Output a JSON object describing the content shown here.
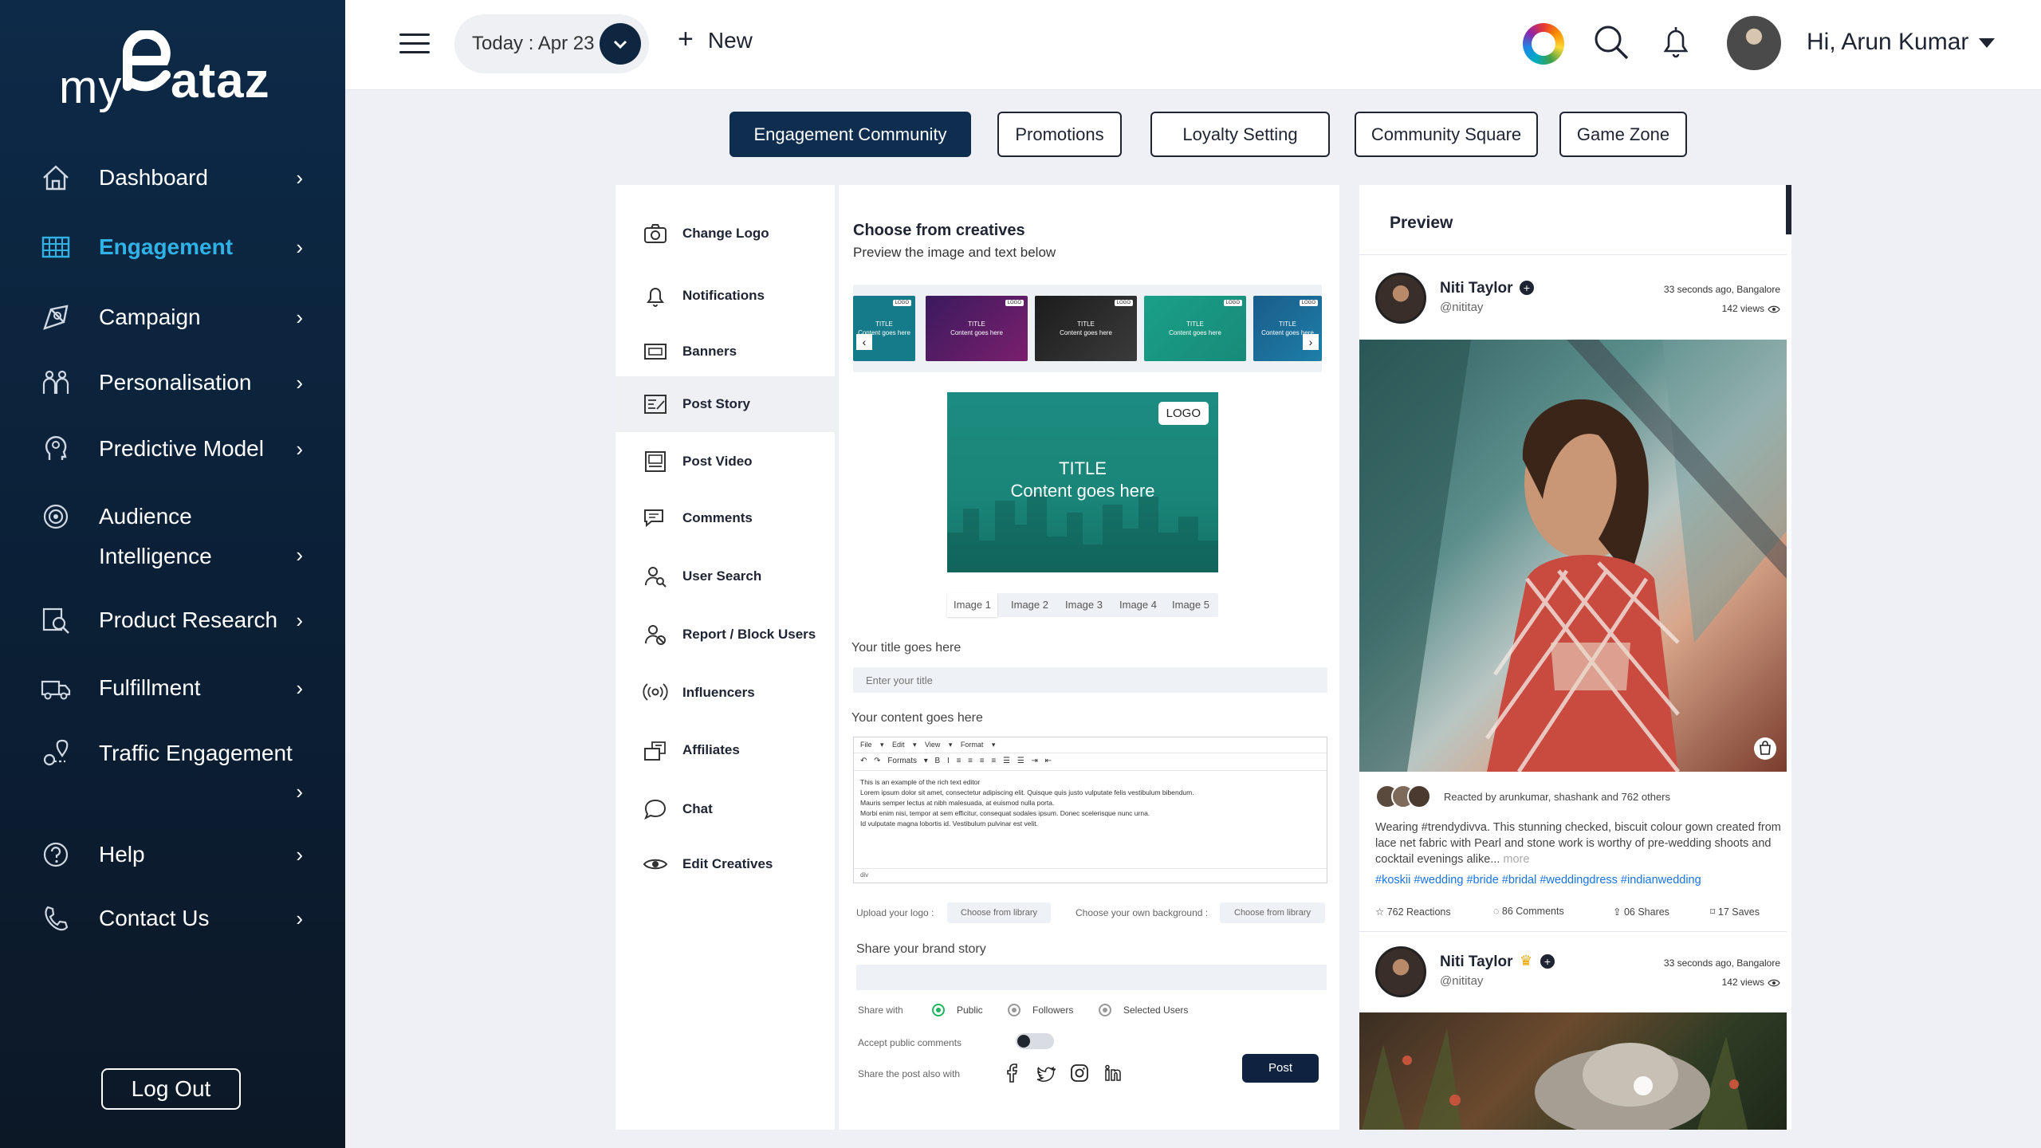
{
  "sidebar": {
    "logo_prefix": "my",
    "logo_suffix": "ataz",
    "logout": "Log Out",
    "items": [
      {
        "label": "Dashboard"
      },
      {
        "label": "Engagement"
      },
      {
        "label": "Campaign"
      },
      {
        "label": "Personalisation"
      },
      {
        "label": "Predictive Model"
      },
      {
        "label": "Audience Intelligence"
      },
      {
        "label": "Product Research"
      },
      {
        "label": "Fulfillment"
      },
      {
        "label": "Traffic Engagement"
      },
      {
        "label": "Help"
      },
      {
        "label": "Contact Us"
      }
    ]
  },
  "topbar": {
    "date_label": "Today : Apr 23",
    "new_label": "New",
    "greeting": "Hi, Arun Kumar"
  },
  "tabs": [
    "Engagement Community",
    "Promotions",
    "Loyalty Setting",
    "Community Square",
    "Game Zone"
  ],
  "menu": [
    "Change Logo",
    "Notifications",
    "Banners",
    "Post Story",
    "Post Video",
    "Comments",
    "User Search",
    "Report / Block Users",
    "Influencers",
    "Affiliates",
    "Chat",
    "Edit Creatives"
  ],
  "editor": {
    "title": "Choose from creatives",
    "subtitle": "Preview the image and text below",
    "thumb_title": "TITLE",
    "thumb_content": "Content goes here",
    "thumb_logo": "LOGO",
    "preview_logo": "LOGO",
    "preview_title": "TITLE",
    "preview_content": "Content goes here",
    "image_tabs": [
      "Image 1",
      "Image 2",
      "Image 3",
      "Image 4",
      "Image 5"
    ],
    "title_label": "Your title goes here",
    "title_placeholder": "Enter your title",
    "content_label": "Your content goes here",
    "rte_menu": "File ▾ Edit ▾ View ▾ Format ▾",
    "rte_tools": "↶ ↷ Formats ▾ B I ≡ ≡ ≡ ≡ ☰ ☰ ⇥ ⇤",
    "rte_line1": "This is an example of the rich text editor",
    "rte_line2": "Lorem ipsum dolor sit amet, consectetur adipiscing elit. Quisque quis justo vulputate felis vestibulum bibendum.",
    "rte_line3": "Mauris semper lectus at nibh malesuada, at euismod nulla porta.",
    "rte_line4": "Morbi enim nisi, tempor at sem efficitur, consequat sodales ipsum. Donec scelerisque nunc urna.",
    "rte_line5": "Id vulputate magna lobortis id. Vestibulum pulvinar est velit.",
    "rte_status": "div",
    "upload_logo_label": "Upload your logo :",
    "choose_library": "Choose from library",
    "own_bg_label": "Choose your own background :",
    "choose_library_2": "Choose from library",
    "brand_story_label": "Share your brand story",
    "share_with_label": "Share with",
    "share_options": [
      "Public",
      "Followers",
      "Selected Users"
    ],
    "accept_comments_label": "Accept public comments",
    "share_also_label": "Share the post also with",
    "post_button": "Post"
  },
  "preview": {
    "title": "Preview",
    "post1": {
      "name": "Niti Taylor",
      "handle": "@nititay",
      "meta": "33 seconds ago, Bangalore",
      "views": "142 views",
      "reacted_by": "Reacted by arunkumar, shashank and 762 others",
      "text": "Wearing #trendydivva. This stunning checked, biscuit colour gown created from lace net fabric with Pearl and stone work is worthy of pre-wedding shoots and cocktail evenings alike...",
      "more": "more",
      "tags": "#koskii #wedding #bride #bridal #weddingdress #indianwedding",
      "reactions": "762 Reactions",
      "comments": "86 Comments",
      "shares": "06 Shares",
      "saves": "17 Saves"
    },
    "post2": {
      "name": "Niti Taylor",
      "handle": "@nititay",
      "meta": "33 seconds ago, Bangalore",
      "views": "142 views"
    }
  }
}
